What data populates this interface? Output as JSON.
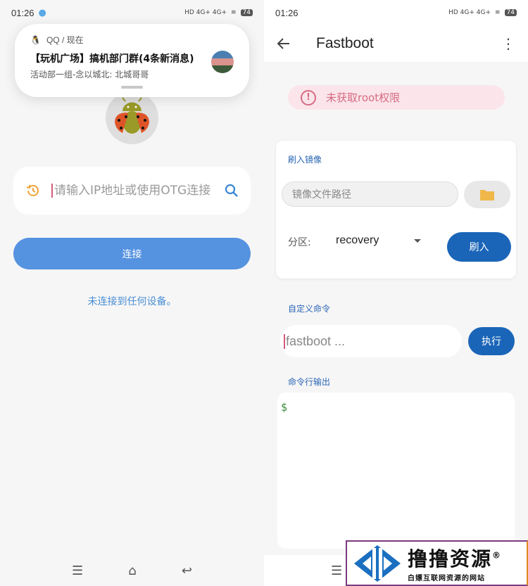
{
  "left": {
    "status": {
      "time": "01:26",
      "signal": "HD 4G+ 4G+",
      "battery": "74"
    },
    "notification": {
      "app": "QQ / 现在",
      "title": "【玩机广场】搞机部门群(4条新消息)",
      "body": "活动部一组-念以城北: 北城哥哥"
    },
    "ip_input": {
      "placeholder": "请输入IP地址或使用OTG连接"
    },
    "connect_label": "连接",
    "status_text": "未连接到任何设备。",
    "nav": {
      "menu": "☰",
      "home": "⌂",
      "back": "↩"
    }
  },
  "right": {
    "status": {
      "time": "01:26",
      "signal": "HD 4G+ 4G+",
      "battery": "74"
    },
    "title": "Fastboot",
    "root_warning": "未获取root权限",
    "flash_section": {
      "label": "刷入镜像",
      "path_placeholder": "镜像文件路径",
      "partition_label": "分区:",
      "partition_value": "recovery",
      "flash_label": "刷入"
    },
    "custom_section": {
      "label": "自定义命令",
      "placeholder": "fastboot ...",
      "exec_label": "执行"
    },
    "output_section": {
      "label": "命令行输出",
      "prompt": "$"
    },
    "nav": {
      "menu": "☰"
    }
  },
  "watermark": {
    "name": "撸撸资源",
    "tagline": "白嫖互联网资源的网站",
    "mark": "®"
  },
  "colors": {
    "accent": "#5592e0",
    "primary": "#1a65b8",
    "warning": "#d56b82"
  }
}
